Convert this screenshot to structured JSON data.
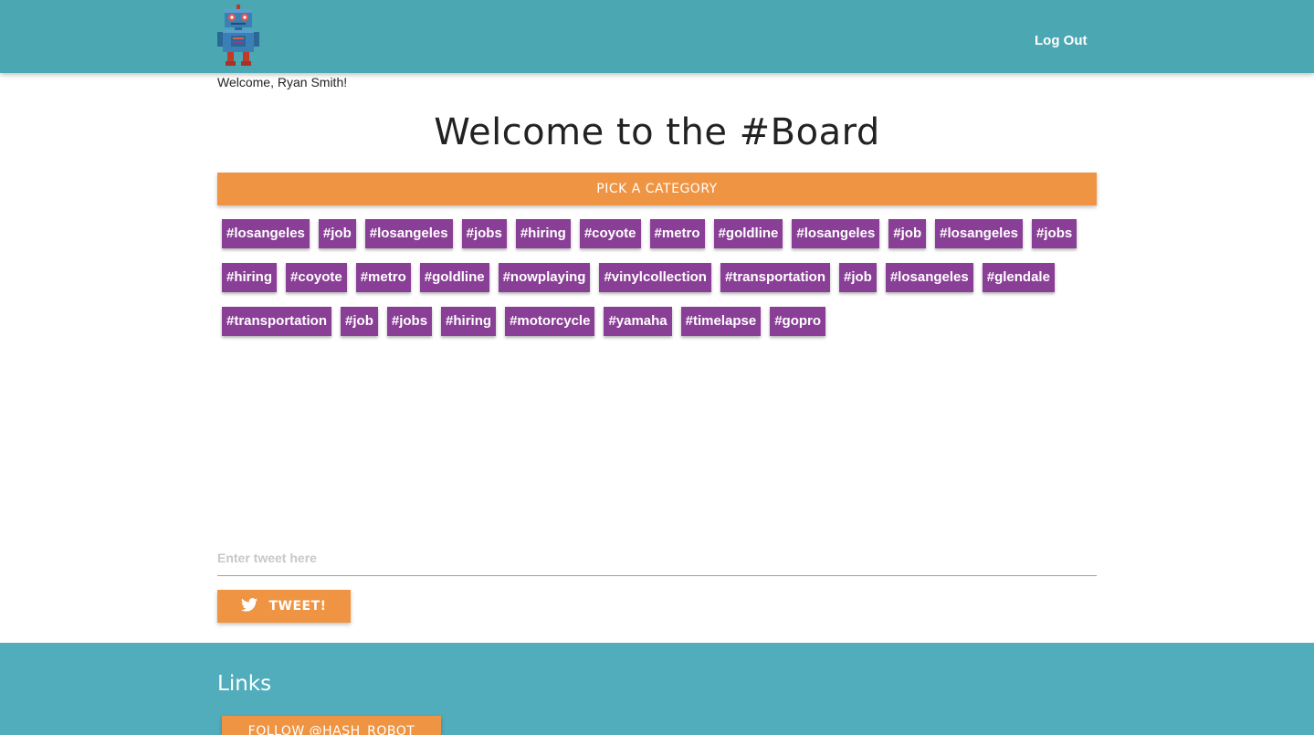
{
  "header": {
    "logo_icon": "robot-logo-icon",
    "logout_label": "Log Out"
  },
  "welcome_user": "Welcome, Ryan Smith!",
  "title": "Welcome to the #Board",
  "category_button_label": "PICK A CATEGORY",
  "tag_rows": [
    [
      "#losangeles",
      "#job",
      "#losangeles",
      "#jobs",
      "#hiring",
      "#coyote",
      "#metro",
      "#goldline",
      "#losangeles",
      "#job",
      "#losangeles",
      "#jobs"
    ],
    [
      "#hiring",
      "#coyote",
      "#metro",
      "#goldline",
      "#nowplaying",
      "#vinylcollection",
      "#transportation",
      "#job",
      "#losangeles",
      "#glendale"
    ],
    [
      "#transportation",
      "#job",
      "#jobs",
      "#hiring",
      "#motorcycle",
      "#yamaha",
      "#timelapse",
      "#gopro"
    ]
  ],
  "tweet": {
    "placeholder": "Enter tweet here",
    "button_label": "TWEET!",
    "button_icon": "twitter-bird-icon"
  },
  "footer": {
    "title": "Links",
    "follow_label": "FOLLOW @HASH_ROBOT"
  },
  "colors": {
    "header_bg": "#4ba7b2",
    "footer_bg": "#51adbb",
    "accent_orange": "#ef9443",
    "tag_purple": "#8a3f96"
  }
}
